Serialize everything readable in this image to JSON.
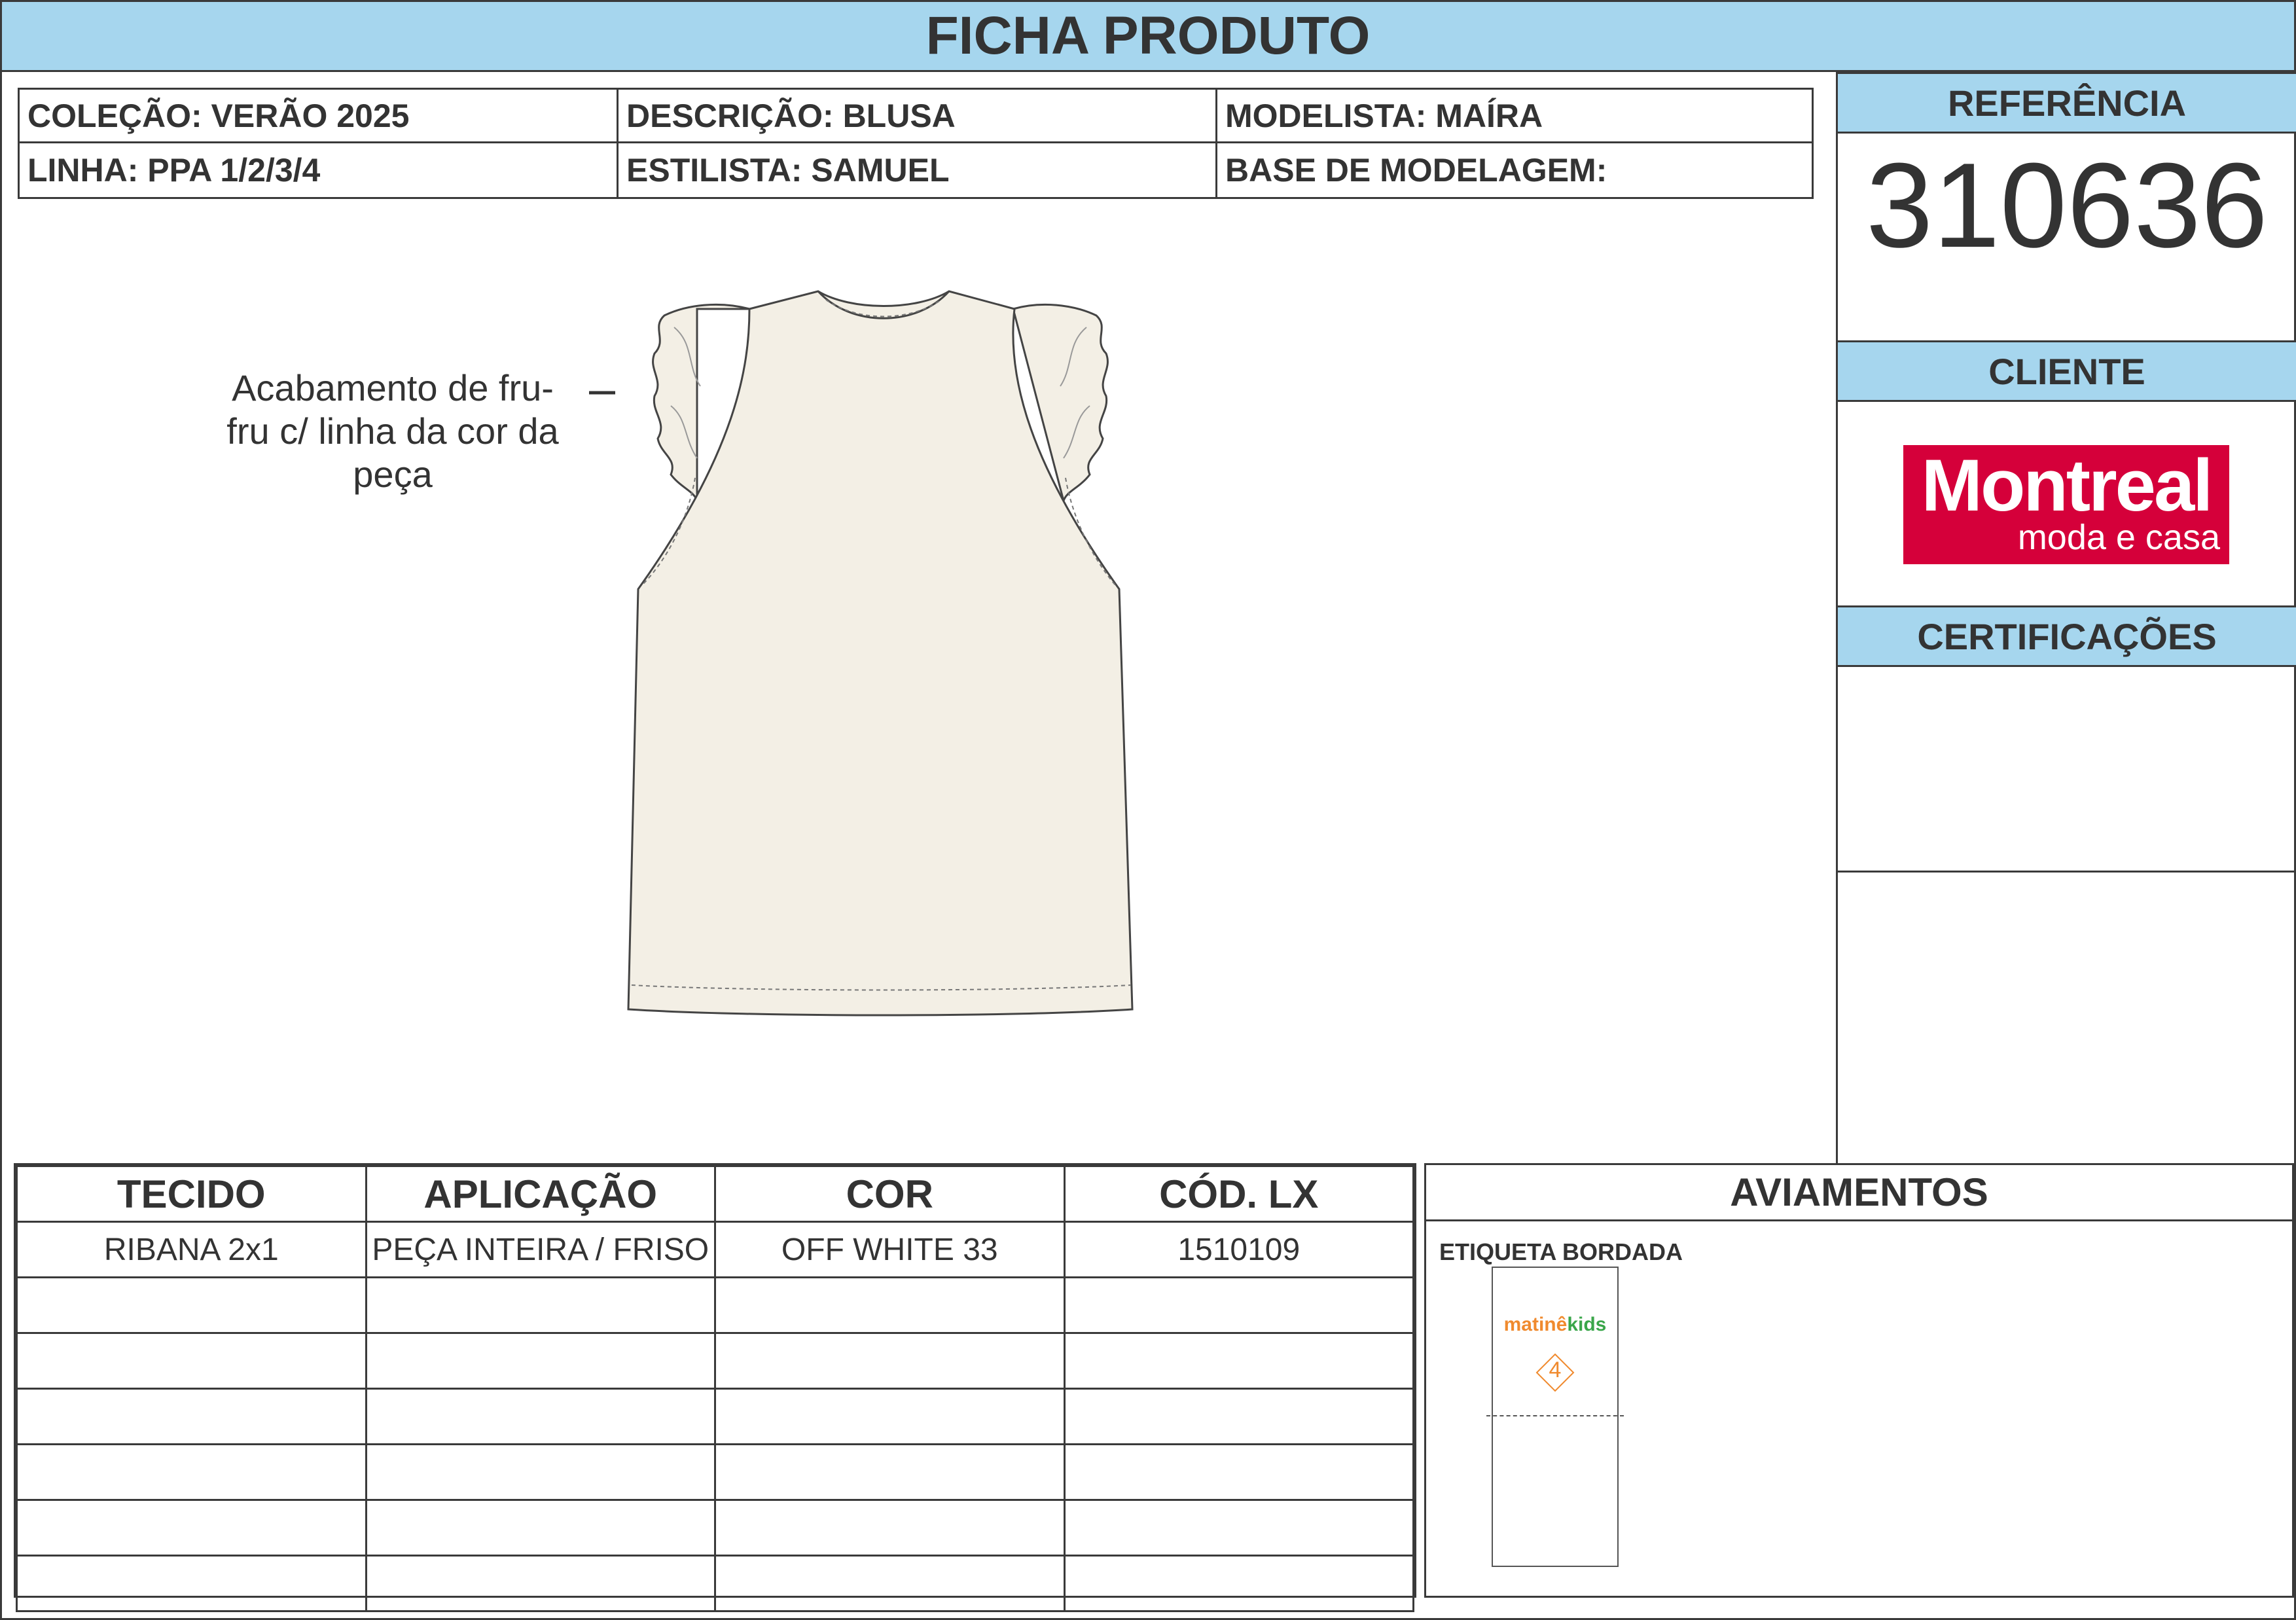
{
  "header": {
    "title": "FICHA PRODUTO"
  },
  "info": {
    "colecao": "COLEÇÃO: VERÃO 2025",
    "descricao": "DESCRIÇÃO: BLUSA",
    "modelista": "MODELISTA: MAÍRA",
    "linha": "LINHA: PPA 1/2/3/4",
    "estilista": "ESTILISTA: SAMUEL",
    "base": "BASE DE MODELAGEM:"
  },
  "sidebar": {
    "referencia_label": "REFERÊNCIA",
    "referencia_value": "310636",
    "cliente_label": "CLIENTE",
    "cliente_logo": {
      "main": "Montreal",
      "sub": "moda e casa",
      "color": "#d5003a"
    },
    "certificacoes_label": "CERTIFICAÇÕES"
  },
  "garment": {
    "callout": "Acabamento de fru-fru c/ linha da cor da peça",
    "fill_color": "#f3efe5"
  },
  "materials": {
    "headers": [
      "TECIDO",
      "APLICAÇÃO",
      "COR",
      "CÓD. LX"
    ],
    "rows": [
      [
        "RIBANA 2x1",
        "PEÇA INTEIRA / FRISO",
        "OFF WHITE 33",
        "1510109"
      ]
    ]
  },
  "aviamentos": {
    "title": "AVIAMENTOS",
    "label": "ETIQUETA BORDADA",
    "tag": {
      "brand_part1": "matinê",
      "brand_part2": "kids",
      "size": "4"
    }
  },
  "colors": {
    "header_bg": "#a6d6ee",
    "border": "#3a3a3a"
  }
}
